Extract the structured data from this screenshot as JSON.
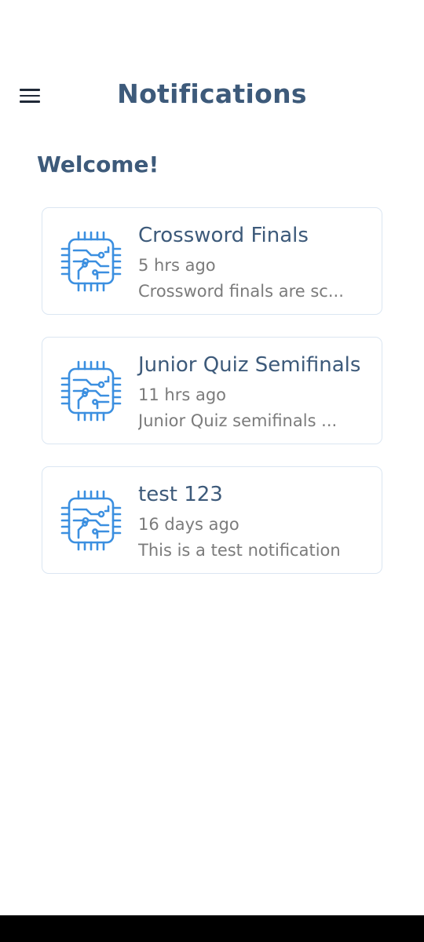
{
  "header": {
    "title": "Notifications"
  },
  "greeting": "Welcome!",
  "notifications": [
    {
      "title": "Crossword Finals",
      "time": "5 hrs ago",
      "preview": "Crossword finals are sc...",
      "icon": "circuit-chip-icon"
    },
    {
      "title": "Junior Quiz Semifinals",
      "time": "11 hrs ago",
      "preview": "Junior Quiz semifinals ...",
      "icon": "circuit-chip-icon"
    },
    {
      "title": "test 123",
      "time": "16 days ago",
      "preview": "This is a test notification",
      "icon": "circuit-chip-icon"
    }
  ],
  "colors": {
    "heading": "#3d5a7a",
    "secondary_text": "#7b7b7b",
    "card_border": "#dbe6f2",
    "icon_blue": "#3b8fe0"
  }
}
